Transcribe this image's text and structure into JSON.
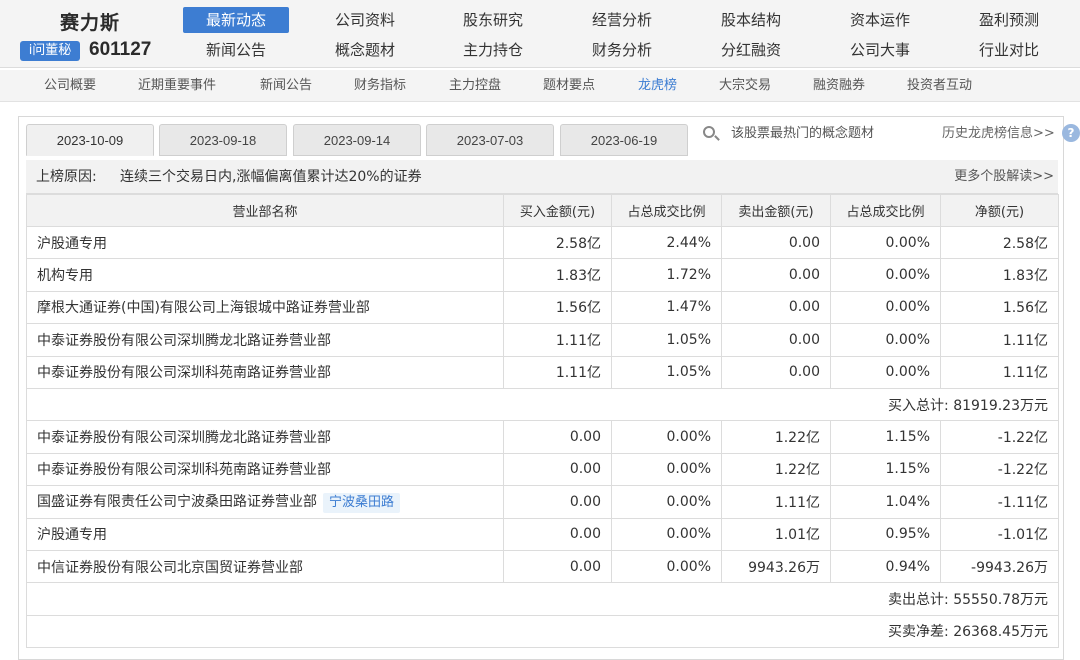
{
  "stock": {
    "name": "赛力斯",
    "badge": "i问董秘",
    "code": "601127"
  },
  "nav": {
    "row1": [
      "最新动态",
      "公司资料",
      "股东研究",
      "经营分析",
      "股本结构",
      "资本运作",
      "盈利预测"
    ],
    "row2": [
      "新闻公告",
      "概念题材",
      "主力持仓",
      "财务分析",
      "分红融资",
      "公司大事",
      "行业对比"
    ],
    "active": "最新动态"
  },
  "subnav": {
    "items": [
      "公司概要",
      "近期重要事件",
      "新闻公告",
      "财务指标",
      "主力控盘",
      "题材要点",
      "龙虎榜",
      "大宗交易",
      "融资融券",
      "投资者互动"
    ],
    "active": "龙虎榜"
  },
  "tabs": [
    "2023-10-09",
    "2023-09-18",
    "2023-09-14",
    "2023-07-03",
    "2023-06-19"
  ],
  "search": {
    "placeholder": "该股票最热门的概念题材",
    "history_link": "历史龙虎榜信息>>"
  },
  "reason": {
    "label": "上榜原因:",
    "text": "连续三个交易日内,涨幅偏离值累计达20%的证券",
    "more": "更多个股解读>>"
  },
  "table": {
    "headers": [
      "营业部名称",
      "买入金额(元)",
      "占总成交比例",
      "卖出金额(元)",
      "占总成交比例",
      "净额(元)"
    ],
    "buy_rows": [
      {
        "name": "沪股通专用",
        "buy": "2.58亿",
        "buy_pct": "2.44%",
        "sell": "0.00",
        "sell_pct": "0.00%",
        "net": "2.58亿"
      },
      {
        "name": "机构专用",
        "buy": "1.83亿",
        "buy_pct": "1.72%",
        "sell": "0.00",
        "sell_pct": "0.00%",
        "net": "1.83亿"
      },
      {
        "name": "摩根大通证券(中国)有限公司上海银城中路证券营业部",
        "buy": "1.56亿",
        "buy_pct": "1.47%",
        "sell": "0.00",
        "sell_pct": "0.00%",
        "net": "1.56亿"
      },
      {
        "name": "中泰证券股份有限公司深圳腾龙北路证券营业部",
        "buy": "1.11亿",
        "buy_pct": "1.05%",
        "sell": "0.00",
        "sell_pct": "0.00%",
        "net": "1.11亿"
      },
      {
        "name": "中泰证券股份有限公司深圳科苑南路证券营业部",
        "buy": "1.11亿",
        "buy_pct": "1.05%",
        "sell": "0.00",
        "sell_pct": "0.00%",
        "net": "1.11亿"
      }
    ],
    "buy_total": "买入总计: 81919.23万元",
    "sell_rows": [
      {
        "name": "中泰证券股份有限公司深圳腾龙北路证券营业部",
        "buy": "0.00",
        "buy_pct": "0.00%",
        "sell": "1.22亿",
        "sell_pct": "1.15%",
        "net": "-1.22亿"
      },
      {
        "name": "中泰证券股份有限公司深圳科苑南路证券营业部",
        "buy": "0.00",
        "buy_pct": "0.00%",
        "sell": "1.22亿",
        "sell_pct": "1.15%",
        "net": "-1.22亿"
      },
      {
        "name": "国盛证券有限责任公司宁波桑田路证券营业部",
        "tag": "宁波桑田路",
        "buy": "0.00",
        "buy_pct": "0.00%",
        "sell": "1.11亿",
        "sell_pct": "1.04%",
        "net": "-1.11亿"
      },
      {
        "name": "沪股通专用",
        "buy": "0.00",
        "buy_pct": "0.00%",
        "sell": "1.01亿",
        "sell_pct": "0.95%",
        "net": "-1.01亿"
      },
      {
        "name": "中信证券股份有限公司北京国贸证券营业部",
        "buy": "0.00",
        "buy_pct": "0.00%",
        "sell": "9943.26万",
        "sell_pct": "0.94%",
        "net": "-9943.26万"
      }
    ],
    "sell_total": "卖出总计: 55550.78万元",
    "net_total": "买卖净差: 26368.45万元"
  }
}
